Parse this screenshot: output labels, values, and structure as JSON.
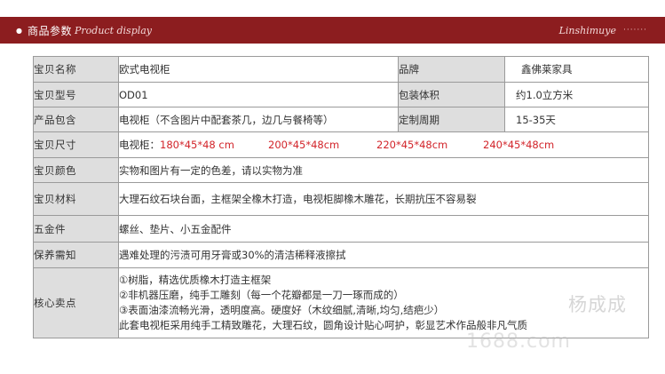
{
  "banner": {
    "title_cn": "商品参数",
    "title_en": "Product display",
    "brand_en": "Linshimuye",
    "dots": "·······"
  },
  "rows": {
    "name": {
      "label": "宝贝名称",
      "value": "欧式电视柜"
    },
    "brand": {
      "label": "品牌",
      "value": "鑫佛莱家具"
    },
    "model": {
      "label": "宝贝型号",
      "value": "OD01"
    },
    "volume": {
      "label": "包装体积",
      "value": "约1.0立方米"
    },
    "contents": {
      "label": "产品包含",
      "value": "电视柜（不含图片中配套茶几，边几与餐椅等）"
    },
    "custom": {
      "label": "定制周期",
      "value": "15-35天"
    },
    "size": {
      "label": "宝贝尺寸",
      "prefix": "电视柜：",
      "values": [
        "180*45*48 cm",
        "200*45*48cm",
        "220*45*48cm",
        "240*45*48cm"
      ]
    },
    "color": {
      "label": "宝贝颜色",
      "value": "实物和图片有一定的色差，请以实物为准"
    },
    "material": {
      "label": "宝贝材料",
      "value": "大理石纹石块台面，主框架全橡木打造，电视柜脚橡木雕花，长期抗压不容易裂"
    },
    "hardware": {
      "label": "五金件",
      "value": "螺丝、垫片、小五金配件"
    },
    "care": {
      "label": "保养需知",
      "value": "遇难处理的污渍可用牙膏或30%的清洁稀释液擦拭"
    },
    "core": {
      "label": "核心卖点",
      "lines": [
        "①树脂，精选优质橡木打造主框架",
        "②非机器压磨，纯手工雕刻（每一个花瓣都是一刀一琢而成的）",
        "③表面油漆流畅光滑，透明度高。硬度好（木纹细腻,清晰,均匀,结疤少）",
        "此套电视柜采用纯手工精致雕花，大理石纹，圆角设计贴心呵护，彰显艺术作品般非凡气质"
      ]
    }
  },
  "watermark": {
    "text": "杨成成",
    "site": "1688.com"
  },
  "colors": {
    "banner": "#8c1d1f",
    "label_bg": "#dedede",
    "accent_red": "#d2242a"
  }
}
